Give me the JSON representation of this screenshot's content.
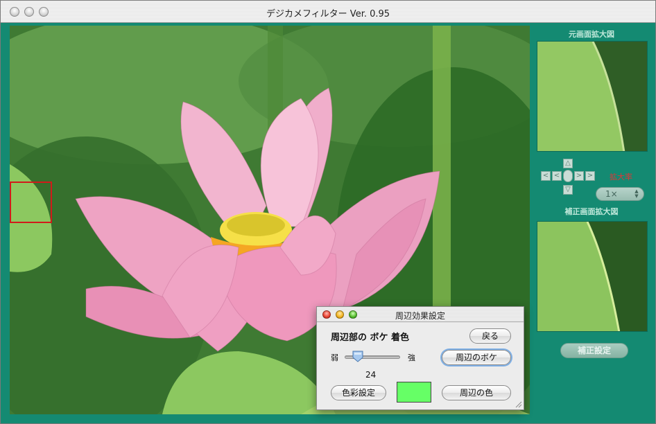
{
  "window": {
    "title": "デジカメフィルター Ver. 0.95"
  },
  "side_panel": {
    "original_zoom_label": "元画面拡大図",
    "corrected_zoom_label": "補正画面拡大図",
    "zoom_rate_label": "拡大率",
    "zoom_rate_value": "1×",
    "nav_buttons": {
      "up": "△",
      "down": "▽",
      "left_far": "<",
      "left": "<",
      "right": ">",
      "right_far": ">"
    },
    "correction_settings_button": "補正設定"
  },
  "dialog": {
    "title": "周辺効果設定",
    "heading": "周辺部の ボケ 着色",
    "back_button": "戻る",
    "slider": {
      "weak_label": "弱",
      "strong_label": "強",
      "value": "24",
      "min": 0,
      "max": 100
    },
    "blur_button": "周辺のボケ",
    "color_settings_button": "色彩設定",
    "peripheral_color_button": "周辺の色",
    "swatch_color": "#66ff66"
  },
  "colors": {
    "background": "#148a72",
    "roi_box": "#d11a1a",
    "swatch": "#66ff66"
  }
}
